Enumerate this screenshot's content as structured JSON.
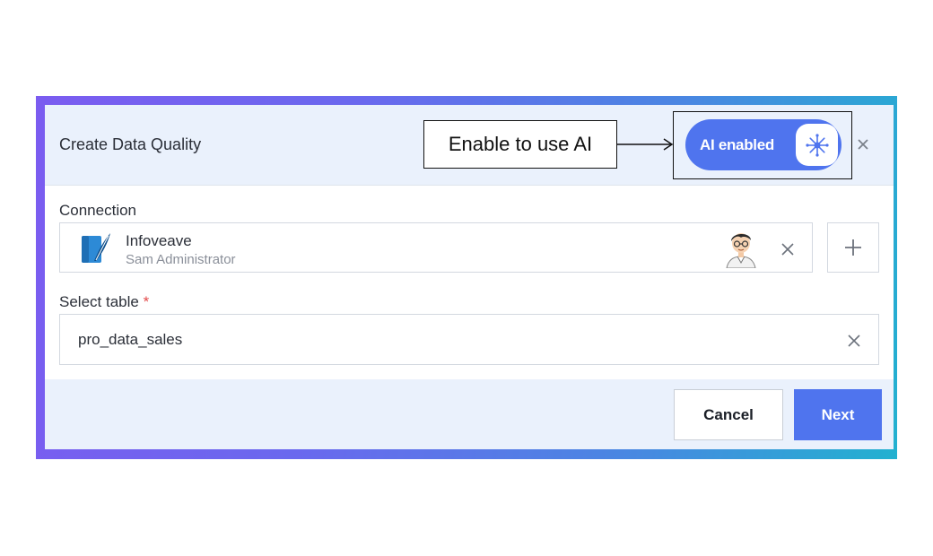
{
  "dialog": {
    "title": "Create Data Quality",
    "callout_text": "Enable to use AI",
    "ai_toggle_label": "AI enabled",
    "ai_toggle_on": true
  },
  "connection": {
    "label": "Connection",
    "name": "Infoveave",
    "user": "Sam Administrator"
  },
  "table": {
    "label": "Select table",
    "required_marker": "*",
    "value": "pro_data_sales"
  },
  "footer": {
    "cancel_label": "Cancel",
    "next_label": "Next"
  },
  "colors": {
    "accent": "#4f74ee",
    "header_bg": "#eaf1fc",
    "required": "#e34b4b"
  },
  "icons": [
    "sparkle-icon",
    "close-icon",
    "database-icon",
    "avatar",
    "plus-icon"
  ]
}
